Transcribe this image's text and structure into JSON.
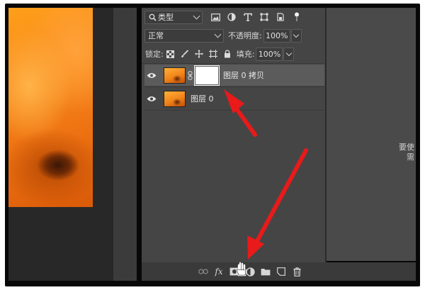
{
  "filter": {
    "kind_label": "类型"
  },
  "blend": {
    "mode": "正常",
    "opacity_label": "不透明度:",
    "opacity_value": "100%"
  },
  "lock": {
    "label": "锁定:",
    "fill_label": "填充:",
    "fill_value": "100%"
  },
  "layers": [
    {
      "name": "图层 0 拷贝"
    },
    {
      "name": "图层 0"
    }
  ],
  "bottom_toolbar": {
    "fx_label": "fx"
  },
  "right_panel": {
    "line1": "要使",
    "line2": "需"
  },
  "colors": {
    "panel": "#454545",
    "selected_layer": "#5b5b5b",
    "arrow": "#e81a1a"
  }
}
